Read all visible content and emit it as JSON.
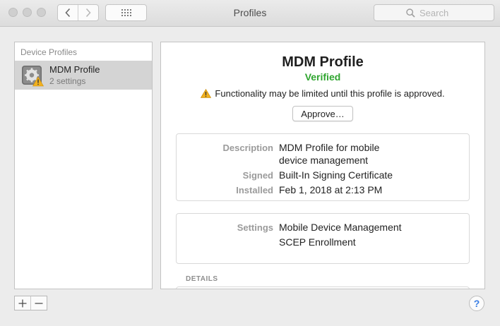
{
  "window": {
    "title": "Profiles"
  },
  "toolbar": {
    "back_icon": "chevron-left-icon",
    "forward_icon": "chevron-right-icon",
    "grid_icon": "grid-icon",
    "search": {
      "placeholder": "Search",
      "value": "",
      "icon": "search-icon"
    }
  },
  "sidebar": {
    "header": "Device Profiles",
    "items": [
      {
        "name": "MDM Profile",
        "subtitle": "2 settings",
        "icon": "gear-profile-icon",
        "badge": "warning-icon",
        "selected": true
      }
    ]
  },
  "detail": {
    "title": "MDM Profile",
    "status": "Verified",
    "status_color": "#2fa52f",
    "warning": "Functionality may be limited until this profile is approved.",
    "warning_icon": "warning-icon",
    "approve_label": "Approve…",
    "info": {
      "description_label": "Description",
      "description_line1": "MDM Profile for mobile",
      "description_line2": "device management",
      "signed_label": "Signed",
      "signed_value": "Built-In Signing Certificate",
      "installed_label": "Installed",
      "installed_value": "Feb 1, 2018 at 2:13 PM"
    },
    "settings": {
      "label": "Settings",
      "items": [
        "Mobile Device Management",
        "SCEP Enrollment"
      ]
    },
    "details_header": "DETAILS"
  },
  "bottom": {
    "add_icon": "plus-icon",
    "remove_icon": "minus-icon",
    "help_label": "?"
  },
  "colors": {
    "accent": "#3a7ee5",
    "selection": "#d4d4d4",
    "warning": "#f2b11e"
  }
}
